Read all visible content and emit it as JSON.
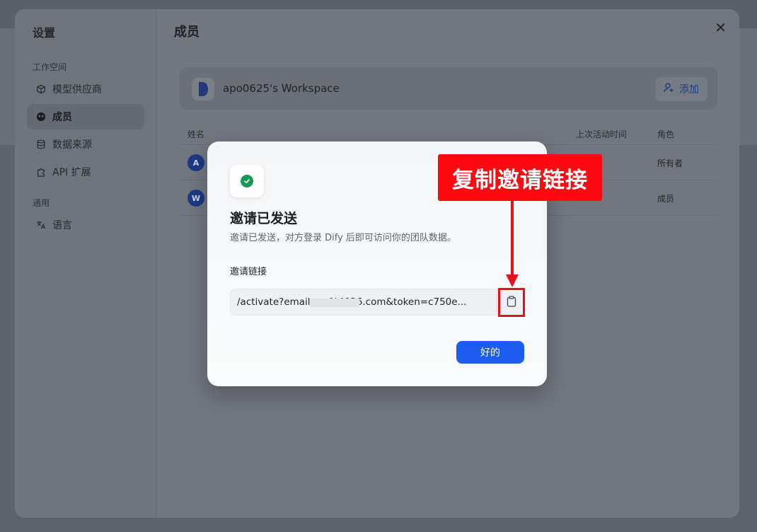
{
  "settings": {
    "title": "设置",
    "groups": [
      {
        "label": "工作空间"
      },
      {
        "label": "通用"
      }
    ],
    "items": [
      {
        "label": "模型供应商",
        "icon": "cube-icon"
      },
      {
        "label": "成员",
        "icon": "members-icon"
      },
      {
        "label": "数据来源",
        "icon": "database-icon"
      },
      {
        "label": "API 扩展",
        "icon": "puzzle-icon"
      },
      {
        "label": "语言",
        "icon": "translate-icon"
      }
    ]
  },
  "main": {
    "title": "成员",
    "workspace_name": "apo0625's Workspace",
    "add_label": "添加",
    "columns": {
      "name": "姓名",
      "last_active": "上次活动时间",
      "role": "角色"
    },
    "rows": [
      {
        "avatar": "A",
        "role": "所有者"
      },
      {
        "avatar": "W",
        "role": "成员"
      }
    ]
  },
  "modal": {
    "title": "邀请已发送",
    "description": "邀请已发送，对方登录 Dify 后即可访问你的团队数据。",
    "link_label": "邀请链接",
    "link_value": "/activate?email=w              %4026.com&token=c750e...",
    "ok_label": "好的"
  },
  "annotation": {
    "label": "复制邀请链接",
    "color": "#fc0a10"
  }
}
